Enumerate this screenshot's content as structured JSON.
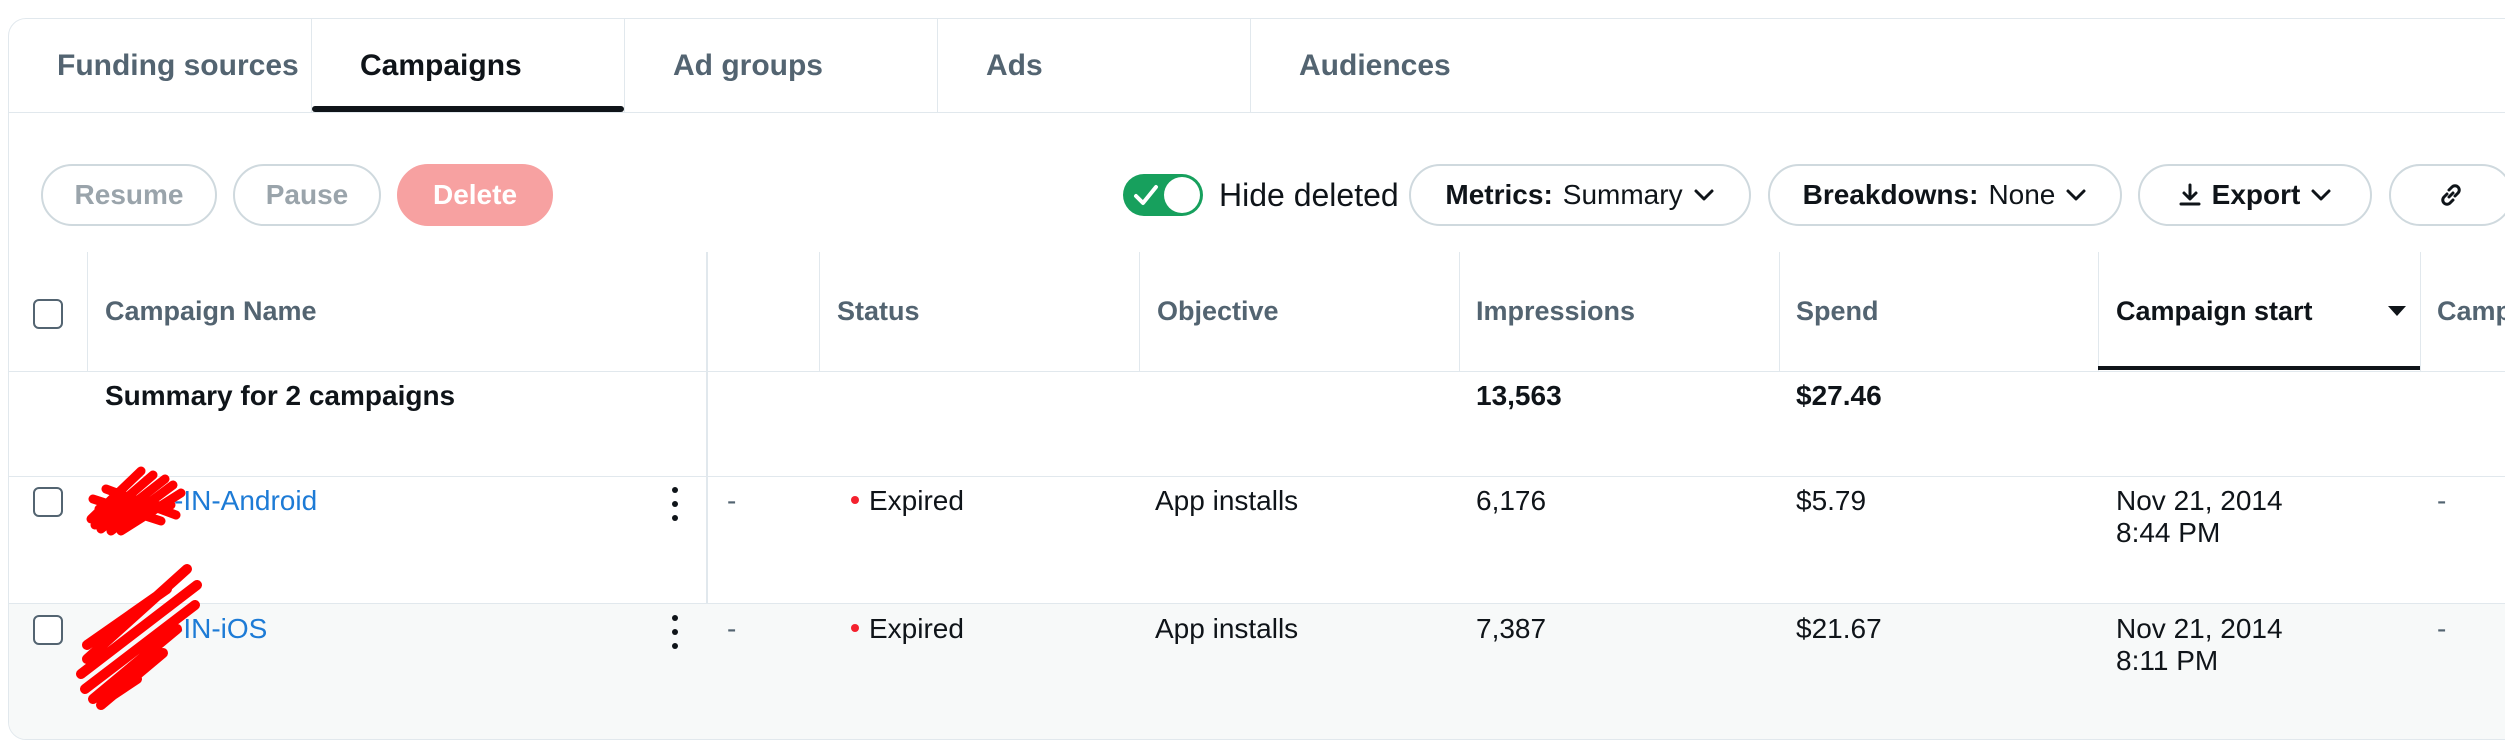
{
  "tabs": [
    {
      "label": "Funding sources"
    },
    {
      "label": "Campaigns"
    },
    {
      "label": "Ad groups"
    },
    {
      "label": "Ads"
    },
    {
      "label": "Audiences"
    }
  ],
  "toolbar": {
    "resume_label": "Resume",
    "pause_label": "Pause",
    "delete_label": "Delete",
    "hide_deleted_label": "Hide deleted",
    "metrics_prefix": "Metrics:",
    "metrics_value": "Summary",
    "breakdowns_prefix": "Breakdowns:",
    "breakdowns_value": "None",
    "export_label": "Export"
  },
  "table": {
    "headers": {
      "campaign_name": "Campaign Name",
      "status": "Status",
      "objective": "Objective",
      "impressions": "Impressions",
      "spend": "Spend",
      "campaign_start": "Campaign start",
      "campaign_end_partial": "Camp"
    },
    "summary": {
      "label": "Summary for 2 campaigns",
      "impressions": "13,563",
      "spend": "$27.46"
    },
    "rows": [
      {
        "name": "-IN-Android",
        "extra": "-",
        "status": "Expired",
        "objective": "App installs",
        "impressions": "6,176",
        "spend": "$5.79",
        "start_date": "Nov 21, 2014",
        "start_time": "8:44 PM",
        "end": "-"
      },
      {
        "name": "-IN-iOS",
        "extra": "-",
        "status": "Expired",
        "objective": "App installs",
        "impressions": "7,387",
        "spend": "$21.67",
        "start_date": "Nov 21, 2014",
        "start_time": "8:11 PM",
        "end": "-"
      }
    ]
  },
  "colors": {
    "accent_link": "#1d7bd6",
    "toggle_on": "#17a05d",
    "delete_button": "#f7a1a1",
    "status_expired": "#f4212e"
  }
}
